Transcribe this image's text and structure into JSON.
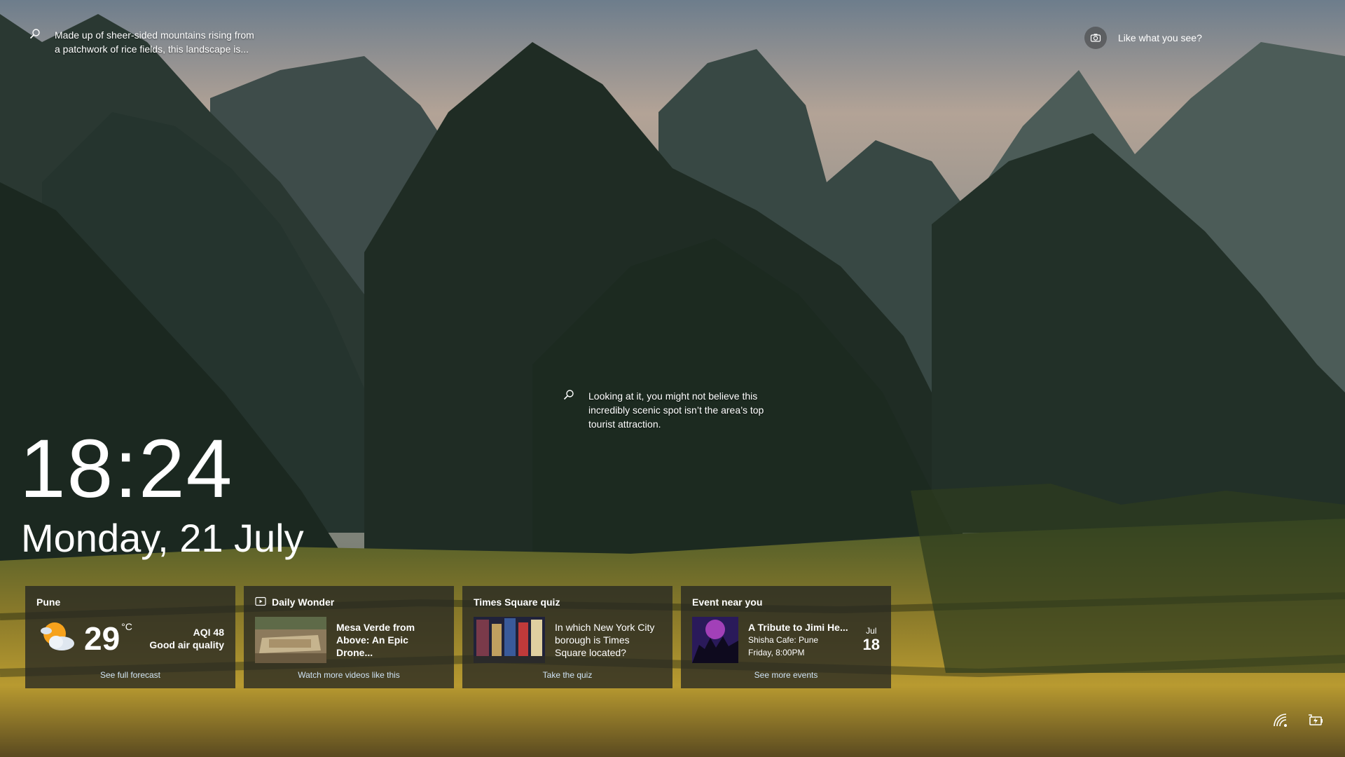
{
  "top_fact": {
    "icon": "search-icon",
    "text": "Made up of sheer-sided mountains rising from a patchwork of rice fields, this landscape is..."
  },
  "like": {
    "icon": "camera-icon",
    "label": "Like what you see?"
  },
  "center_fact": {
    "icon": "search-icon",
    "text": "Looking at it, you might not believe this incredibly scenic spot isn’t the area’s top tourist attraction."
  },
  "clock": {
    "time": "18:24",
    "date": "Monday, 21 July"
  },
  "cards": {
    "weather": {
      "city": "Pune",
      "icon": "partly-cloudy-icon",
      "temp": "29",
      "unit": "°C",
      "aqi": "AQI 48",
      "aqi_desc": "Good air quality",
      "link": "See full forecast"
    },
    "wonder": {
      "title": "Daily Wonder",
      "icon": "video-icon",
      "headline": "Mesa Verde from Above: An Epic Drone...",
      "link": "Watch more videos like this"
    },
    "quiz": {
      "title": "Times Square quiz",
      "question": "In which New York City borough is Times Square located?",
      "link": "Take the quiz"
    },
    "event": {
      "title": "Event near you",
      "name": "A Tribute to Jimi He...",
      "venue": "Shisha Cafe: Pune",
      "when": "Friday, 8:00PM",
      "month": "Jul",
      "day": "18",
      "link": "See more events"
    }
  },
  "tray": {
    "network_icon": "wifi-icon",
    "power_icon": "battery-charging-icon"
  }
}
